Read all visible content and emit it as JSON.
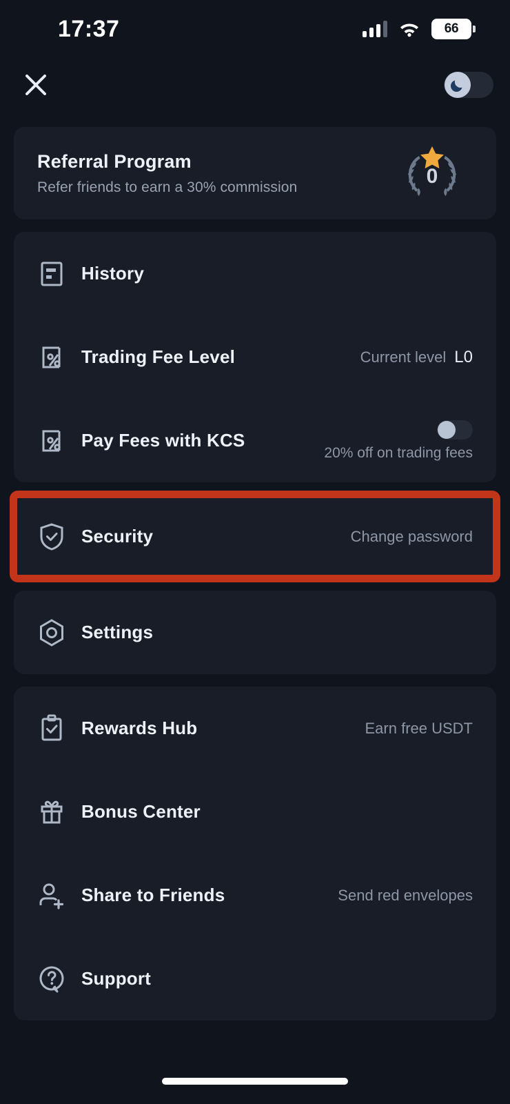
{
  "status_bar": {
    "time": "17:37",
    "battery_level": "66",
    "signal_icon": "cellular-signal-icon",
    "wifi_icon": "wifi-icon",
    "battery_icon": "battery-icon"
  },
  "header": {
    "close_icon": "close-icon",
    "dark_mode_toggle": {
      "name": "dark-mode-toggle",
      "icon": "moon-icon",
      "state": "on"
    }
  },
  "referral": {
    "title": "Referral Program",
    "subtitle": "Refer friends to earn a 30% commission",
    "badge_count": "0",
    "badge_icon": "laurel-wreath-star-icon"
  },
  "groups": [
    {
      "name": "account-group",
      "rows": [
        {
          "label": "History",
          "icon": "history-document-icon",
          "value": "",
          "value_strong": "",
          "note": "",
          "toggle": null
        },
        {
          "label": "Trading Fee Level",
          "icon": "percent-fee-icon",
          "value": "Current level",
          "value_strong": "L0",
          "note": "",
          "toggle": null
        },
        {
          "label": "Pay Fees with KCS",
          "icon": "percent-fee-icon",
          "value": "",
          "value_strong": "",
          "note": "20% off on trading fees",
          "toggle": "off"
        }
      ]
    },
    {
      "name": "security-group",
      "rows": [
        {
          "label": "Security",
          "icon": "shield-check-icon",
          "value": "Change password",
          "value_strong": "",
          "note": "",
          "toggle": null,
          "highlighted": true
        },
        {
          "label": "Settings",
          "icon": "gear-hex-icon",
          "value": "",
          "value_strong": "",
          "note": "",
          "toggle": null
        }
      ]
    },
    {
      "name": "rewards-group",
      "rows": [
        {
          "label": "Rewards Hub",
          "icon": "clipboard-check-icon",
          "value": "Earn free USDT",
          "value_strong": "",
          "note": "",
          "toggle": null
        },
        {
          "label": "Bonus Center",
          "icon": "gift-icon",
          "value": "",
          "value_strong": "",
          "note": "",
          "toggle": null
        },
        {
          "label": "Share to Friends",
          "icon": "user-plus-icon",
          "value": "Send red envelopes",
          "value_strong": "",
          "note": "",
          "toggle": null
        },
        {
          "label": "Support",
          "icon": "question-bubble-icon",
          "value": "",
          "value_strong": "",
          "note": "",
          "toggle": null
        }
      ]
    }
  ],
  "colors": {
    "page_background": "#10151d",
    "card_background": "#181d28",
    "highlight_border": "#c2351b",
    "star": "#f0a93c",
    "text_primary": "#eef2f8",
    "text_secondary": "#8e97a6"
  },
  "home_indicator": "home-indicator"
}
